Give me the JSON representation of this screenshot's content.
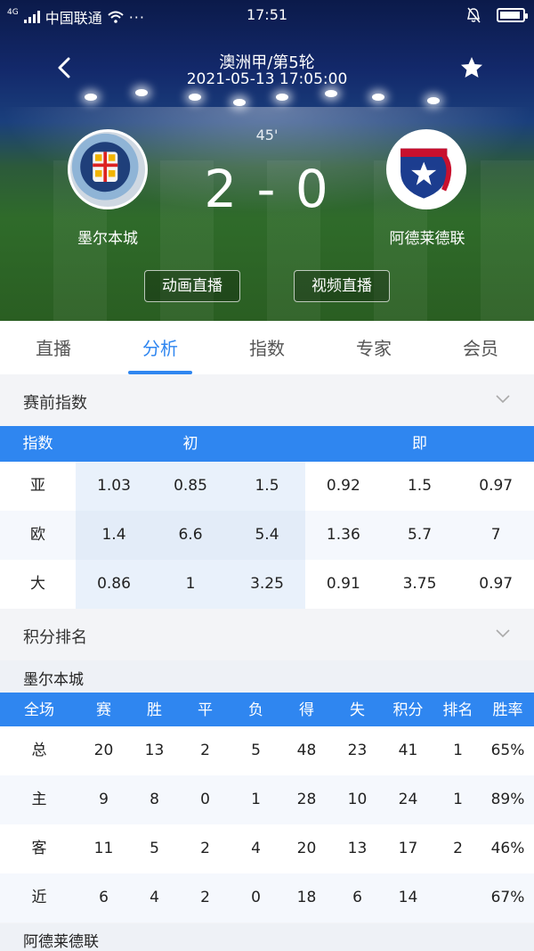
{
  "status_bar": {
    "network": "4G",
    "carrier": "中国联通",
    "dots": "···",
    "time": "17:51"
  },
  "match": {
    "league_round": "澳洲甲/第5轮",
    "datetime": "2021-05-13 17:05:00",
    "minute": "45'",
    "score": "2 - 0",
    "home_team": "墨尔本城",
    "away_team": "阿德莱德联",
    "home_logo_text": "MELBOURNE CITY FOOTBALL CLUB",
    "away_logo_text": "ADELAIDE UNITED F.C."
  },
  "buttons": {
    "animation_live": "动画直播",
    "video_live": "视频直播"
  },
  "tabs": [
    {
      "label": "直播",
      "active": false
    },
    {
      "label": "分析",
      "active": true
    },
    {
      "label": "指数",
      "active": false
    },
    {
      "label": "专家",
      "active": false
    },
    {
      "label": "会员",
      "active": false
    }
  ],
  "odds": {
    "section_title": "赛前指数",
    "header": {
      "label": "指数",
      "initial": "初",
      "current": "即"
    },
    "rows": [
      {
        "label": "亚",
        "initial": [
          "1.03",
          "0.85",
          "1.5"
        ],
        "current": [
          "0.92",
          "1.5",
          "0.97"
        ]
      },
      {
        "label": "欧",
        "initial": [
          "1.4",
          "6.6",
          "5.4"
        ],
        "current": [
          "1.36",
          "5.7",
          "7"
        ]
      },
      {
        "label": "大",
        "initial": [
          "0.86",
          "1",
          "3.25"
        ],
        "current": [
          "0.91",
          "3.75",
          "0.97"
        ]
      }
    ]
  },
  "standings": {
    "section_title": "积分排名",
    "home_team": "墨尔本城",
    "away_team": "阿德莱德联",
    "columns": [
      "全场",
      "赛",
      "胜",
      "平",
      "负",
      "得",
      "失",
      "积分",
      "排名",
      "胜率"
    ],
    "rows": [
      [
        "总",
        "20",
        "13",
        "2",
        "5",
        "48",
        "23",
        "41",
        "1",
        "65%"
      ],
      [
        "主",
        "9",
        "8",
        "0",
        "1",
        "28",
        "10",
        "24",
        "1",
        "89%"
      ],
      [
        "客",
        "11",
        "5",
        "2",
        "4",
        "20",
        "13",
        "17",
        "2",
        "46%"
      ],
      [
        "近",
        "6",
        "4",
        "2",
        "0",
        "18",
        "6",
        "14",
        "",
        "67%"
      ]
    ]
  },
  "colors": {
    "accent": "#2f86f0",
    "page_bg": "#f3f4f7"
  },
  "icons": [
    "signal-icon",
    "wifi-icon",
    "bell-mute-icon",
    "battery-icon",
    "back-arrow-icon",
    "star-icon",
    "chevron-down-icon"
  ]
}
